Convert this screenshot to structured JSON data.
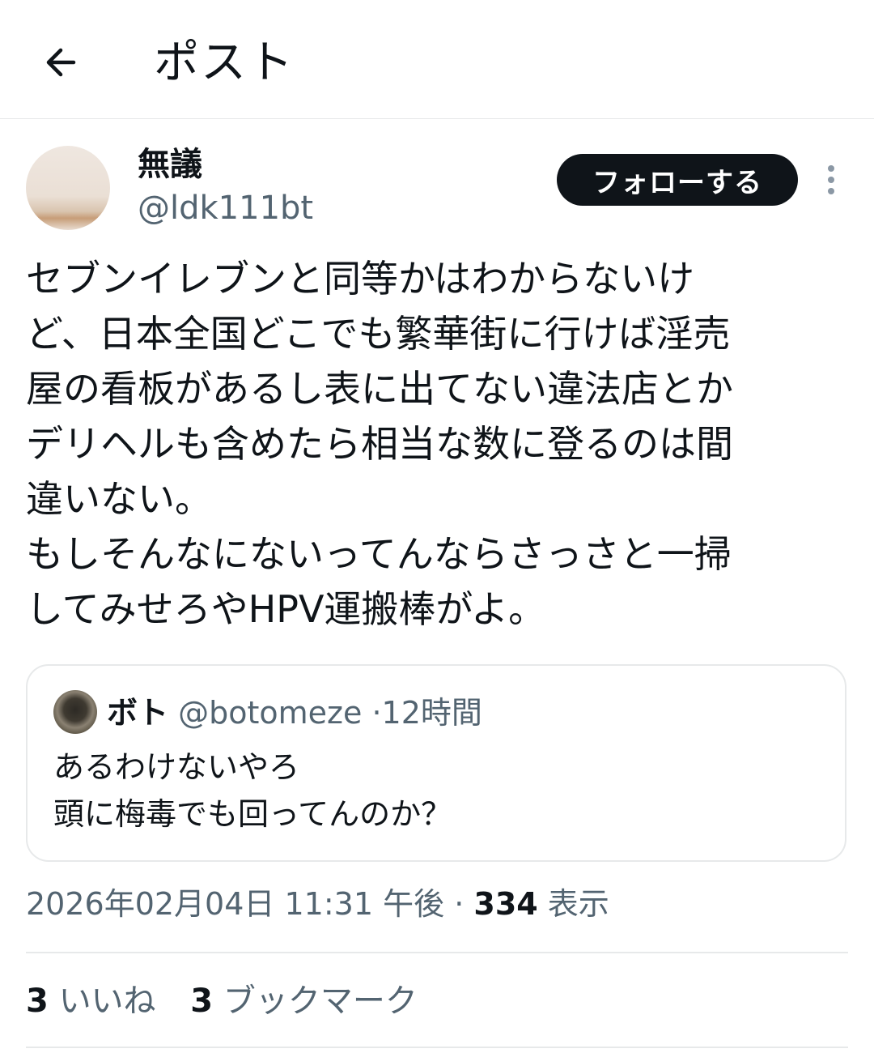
{
  "header": {
    "title": "ポスト",
    "back_icon": "arrow-left-icon"
  },
  "author": {
    "display_name": "無議",
    "handle": "@ldk111bt",
    "follow_label": "フォローする",
    "more_icon": "vertical-ellipsis-icon"
  },
  "post": {
    "text": "セブンイレブンと同等かはわからないけ\nど、日本全国どこでも繁華街に行けば淫売\n屋の看板があるし表に出てない違法店とか\nデリヘルも含めたら相当な数に登るのは間\n違いない。\nもしそんなにないってんならさっさと一掃\nしてみせろやHPV運搬棒がよ。"
  },
  "quote": {
    "name": "ボト",
    "handle": "@botomeze",
    "separator": "·",
    "time": "12時間",
    "text": "あるわけないやろ\n頭に梅毒でも回ってんのか？"
  },
  "meta": {
    "timestamp": "2026年02月04日 11:31 午後",
    "separator": "·",
    "views_count": "334",
    "views_label": "表示"
  },
  "stats": {
    "likes_count": "3",
    "likes_label": "いいね",
    "bookmarks_count": "3",
    "bookmarks_label": "ブックマーク"
  },
  "colors": {
    "text_primary": "#0f1419",
    "text_secondary": "#536471",
    "border": "#e7e9ea",
    "button_bg": "#0f1419"
  }
}
